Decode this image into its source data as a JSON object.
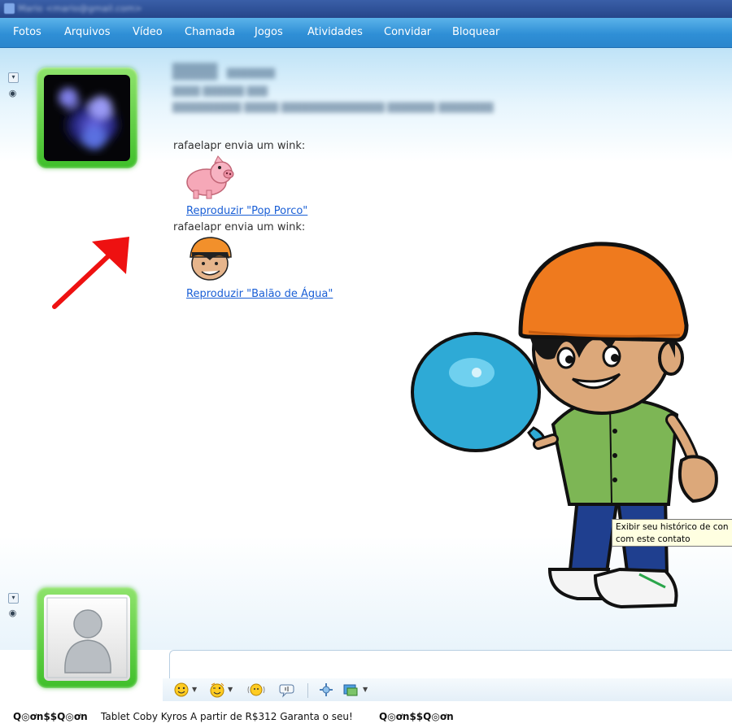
{
  "window": {
    "title": "Mario <mario@gmail.com>"
  },
  "menu": [
    "Fotos",
    "Arquivos",
    "Vídeo",
    "Chamada",
    "Jogos",
    "Atividades",
    "Convidar",
    "Bloquear"
  ],
  "conversation": {
    "messages": [
      {
        "text": "rafaelapr envia um wink:",
        "link": "Reproduzir \"Pop Porco\""
      },
      {
        "text": "rafaelapr envia um wink:",
        "link": "Reproduzir \"Balão de Água\""
      }
    ]
  },
  "tooltip": {
    "line1": "Exibir seu histórico de con",
    "line2": "com este contato"
  },
  "toolbar": {
    "icons": [
      "emoticon-icon",
      "wink-icon",
      "nudge-icon",
      "voice-clip-icon",
      "background-icon",
      "change-display-icon"
    ]
  },
  "ad": {
    "logo_left": "Q◎ơn$$Q◎ơn",
    "text": "Tablet Coby Kyros A partir de R$312 Garanta o seu!",
    "logo_right": "Q◎ơn$$Q◎ơn"
  },
  "colors": {
    "menubar": "#2f8fd6",
    "avatar_frame": "#3fbf2a",
    "link": "#1a5fd6",
    "arrow": "#ee1111"
  }
}
